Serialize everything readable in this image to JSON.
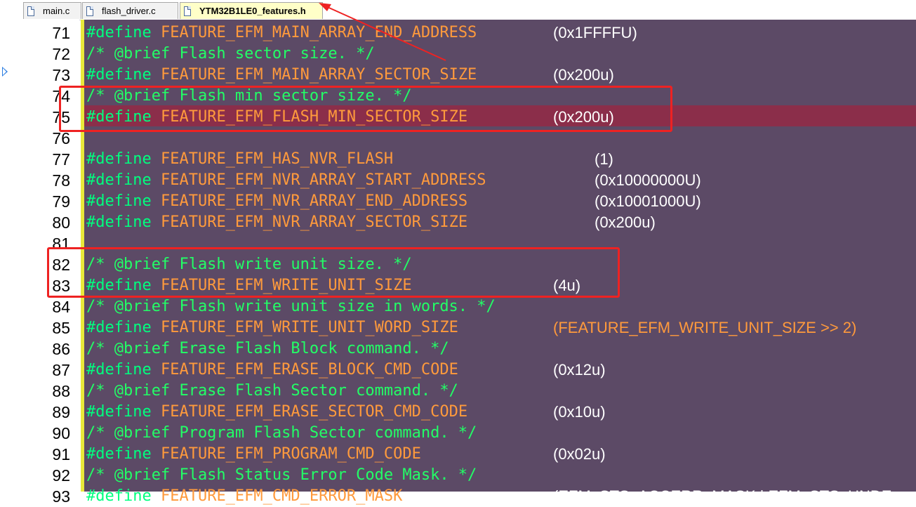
{
  "tabs": [
    {
      "label": "main.c",
      "active": false
    },
    {
      "label": "flash_driver.c",
      "active": false
    },
    {
      "label": "YTM32B1LE0_features.h",
      "active": true
    }
  ],
  "lines": [
    {
      "num": "71",
      "type": "define",
      "kw": "#define",
      "name": "FEATURE_EFM_MAIN_ARRAY_END_ADDRESS",
      "value": "(0x1FFFFU)"
    },
    {
      "num": "72",
      "type": "comment",
      "text": "/* @brief Flash sector size. */"
    },
    {
      "num": "73",
      "type": "define",
      "kw": "#define",
      "name": "FEATURE_EFM_MAIN_ARRAY_SECTOR_SIZE",
      "value": "(0x200u)"
    },
    {
      "num": "74",
      "type": "comment",
      "text": "/* @brief Flash min sector size. */"
    },
    {
      "num": "75",
      "type": "define",
      "kw": "#define",
      "name": "FEATURE_EFM_FLASH_MIN_SECTOR_SIZE",
      "value": "(0x200u)"
    },
    {
      "num": "76",
      "type": "blank"
    },
    {
      "num": "77",
      "type": "define",
      "kw": "#define",
      "name": "FEATURE_EFM_HAS_NVR_FLASH",
      "value": "(1)"
    },
    {
      "num": "78",
      "type": "define",
      "kw": "#define",
      "name": "FEATURE_EFM_NVR_ARRAY_START_ADDRESS",
      "value": "(0x10000000U)"
    },
    {
      "num": "79",
      "type": "define",
      "kw": "#define",
      "name": "FEATURE_EFM_NVR_ARRAY_END_ADDRESS",
      "value": "(0x10001000U)"
    },
    {
      "num": "80",
      "type": "define",
      "kw": "#define",
      "name": "FEATURE_EFM_NVR_ARRAY_SECTOR_SIZE",
      "value": "(0x200u)"
    },
    {
      "num": "81",
      "type": "blank"
    },
    {
      "num": "82",
      "type": "comment",
      "text": "/* @brief Flash write unit size. */"
    },
    {
      "num": "83",
      "type": "define",
      "kw": "#define",
      "name": "FEATURE_EFM_WRITE_UNIT_SIZE",
      "value": "(4u)"
    },
    {
      "num": "84",
      "type": "comment",
      "text": "/* @brief Flash write unit size in words. */"
    },
    {
      "num": "85",
      "type": "define",
      "kw": "#define",
      "name": "FEATURE_EFM_WRITE_UNIT_WORD_SIZE",
      "value": "(FEATURE_EFM_WRITE_UNIT_SIZE >> 2)"
    },
    {
      "num": "86",
      "type": "comment",
      "text": "/* @brief Erase Flash Block command. */"
    },
    {
      "num": "87",
      "type": "define",
      "kw": "#define",
      "name": "FEATURE_EFM_ERASE_BLOCK_CMD_CODE",
      "value": "(0x12u)"
    },
    {
      "num": "88",
      "type": "comment",
      "text": "/* @brief Erase Flash Sector command. */"
    },
    {
      "num": "89",
      "type": "define",
      "kw": "#define",
      "name": "FEATURE_EFM_ERASE_SECTOR_CMD_CODE",
      "value": "(0x10u)"
    },
    {
      "num": "90",
      "type": "comment",
      "text": "/* @brief Program Flash Sector command. */"
    },
    {
      "num": "91",
      "type": "define",
      "kw": "#define",
      "name": "FEATURE_EFM_PROGRAM_CMD_CODE",
      "value": "(0x02u)"
    },
    {
      "num": "92",
      "type": "comment",
      "text": "/* @brief Flash Status Error Code Mask. */"
    },
    {
      "num": "93",
      "type": "define",
      "kw": "#define",
      "name": "FEATURE_EFM_CMD_ERROR_MASK",
      "value": "(EFM_STS_ACCERR_MASK | EFM_STS_UNDE"
    }
  ],
  "colors": {
    "editor_bg": "#5c4a66",
    "keyword": "#00ff7f",
    "macro": "#ff9a3c",
    "comment": "#22ff66",
    "value": "#ffffff",
    "current_line": "#8b2e4a",
    "annotation": "#ee2222"
  }
}
